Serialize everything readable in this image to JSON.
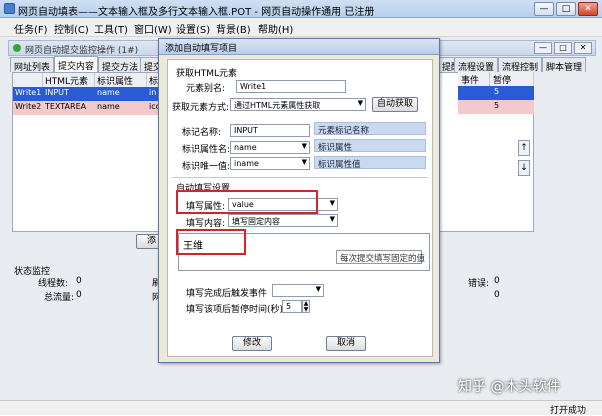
{
  "main_window": {
    "title": "网页自动填表——文本输入框及多行文本输入框.POT - 网页自动操作通用 已注册",
    "buttons": {
      "minimize": "—",
      "maximize": "□",
      "close": "✕"
    }
  },
  "menu": [
    "任务(F)",
    "控制(C)",
    "工具(T)",
    "窗口(W)",
    "设置(S)",
    "背景(B)",
    "帮助(H)"
  ],
  "sub_window": {
    "title": "网页自动提交监控操作 (1#)",
    "buttons": {
      "minimize": "—",
      "maximize": "□",
      "close": "✕"
    }
  },
  "tabs": [
    "网址列表",
    "提交内容",
    "提交方法",
    "提交选",
    "提醒",
    "流程设置",
    "流程控制",
    "脚本管理"
  ],
  "grid": {
    "headers": [
      "HTML元素",
      "标识属性",
      "标"
    ],
    "rows": [
      {
        "name": "Write1",
        "elem": "INPUT",
        "attr": "name",
        "extra": "in"
      },
      {
        "name": "Write2",
        "elem": "TEXTAREA",
        "attr": "name",
        "extra": "ico"
      }
    ],
    "right_headers": [
      "事件",
      "暂停"
    ],
    "right_rows": [
      [
        "",
        "5"
      ],
      [
        "",
        "5"
      ]
    ],
    "add_button_partial": "添"
  },
  "status": {
    "heading": "状态监控",
    "thread_label": "线程数:",
    "thread_value": "0",
    "flow_label": "总流量:",
    "flow_value": "0",
    "col2_a": "刷",
    "col2_b": "网",
    "error_label": "错误:",
    "error_value": "0",
    "col3_b_value": "0"
  },
  "status_bar": {
    "text": "打开成功"
  },
  "dialog": {
    "title": "添加自动填写项目",
    "section_fetch": "获取HTML元素",
    "alias_label": "元素别名:",
    "alias_value": "Write1",
    "method_label": "获取元素方式:",
    "method_value": "通过HTML元素属性获取",
    "auto_fetch_button": "自动获取",
    "tag_label": "标记名称:",
    "tag_value": "INPUT",
    "tag_hint": "元素标记名称",
    "attr_label": "标识属性名:",
    "attr_value": "name",
    "attr_hint": "标识属性",
    "unique_label": "标识唯一值:",
    "unique_value": "iname",
    "unique_hint": "标识属性值",
    "section_fill": "自动填写设置",
    "fill_attr_label": "填写属性:",
    "fill_attr_value": "value",
    "fill_content_label": "填写内容:",
    "fill_content_value": "填写固定内容",
    "textarea_value": "王维",
    "tooltip": "每次提交填写固定的值",
    "event_label": "填写完成后触发事件",
    "pause_label": "填写该项后暂停时间(秒)",
    "pause_value": "5",
    "ok_button": "修改",
    "cancel_button": "取消"
  },
  "watermark": "知乎 @木头软件",
  "colors": {
    "selected_row": "#2a5bd7",
    "alt_row": "#f3c9cc",
    "hint_bg": "#c9daf0",
    "highlight_box": "#d3232b"
  }
}
